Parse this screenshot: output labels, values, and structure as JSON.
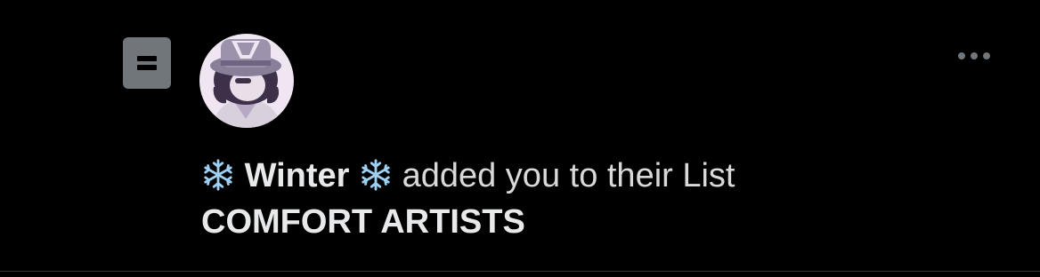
{
  "notification": {
    "user": {
      "name_prefix_emoji": "snowflake-icon",
      "name": "Winter",
      "name_suffix_emoji": "snowflake-icon"
    },
    "action_text": "added you to their List",
    "list_name": "COMFORT ARTISTS",
    "icons": {
      "type": "list-icon",
      "menu": "more-icon"
    }
  },
  "colors": {
    "background": "#000000",
    "text_primary": "#e7e9ea",
    "icon_gray": "#71767b",
    "divider": "#2f3336",
    "snowflake": "#9fd0f2"
  }
}
